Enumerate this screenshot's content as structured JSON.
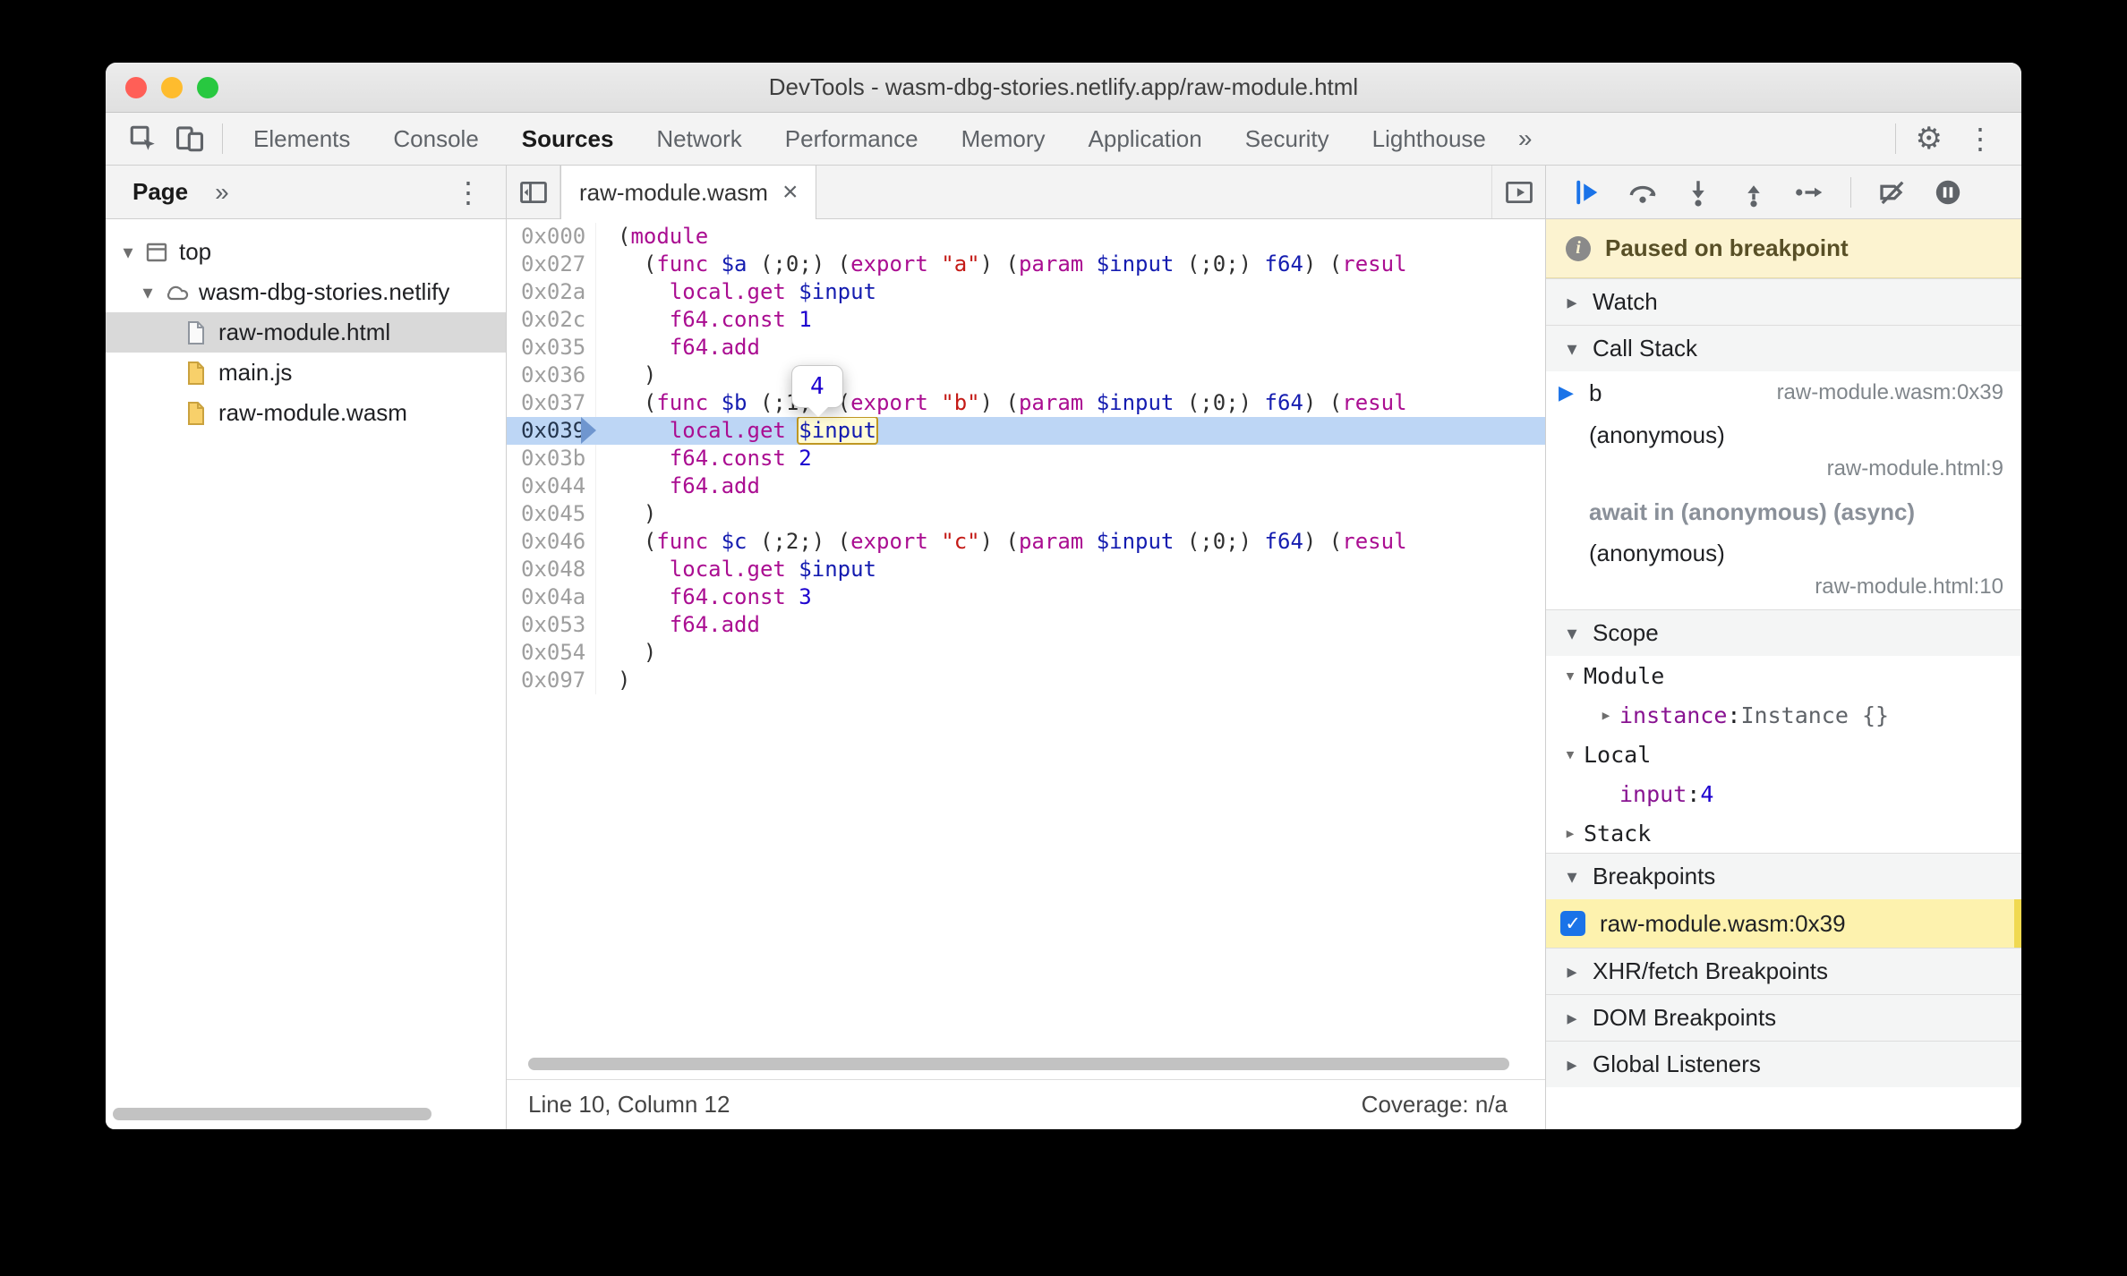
{
  "window": {
    "title": "DevTools - wasm-dbg-stories.netlify.app/raw-module.html"
  },
  "icons": {
    "settings_gear": "⚙",
    "menu_kebab": "⋮",
    "more_tabs": "»",
    "close": "×",
    "cloud": "☁",
    "check": "✓",
    "info": "i",
    "twisty_open": "▾",
    "twisty_closed": "▸",
    "active_frame": "▶"
  },
  "main_toolbar": {
    "active_tab": "Sources",
    "tabs": [
      "Elements",
      "Console",
      "Sources",
      "Network",
      "Performance",
      "Memory",
      "Application",
      "Security",
      "Lighthouse"
    ]
  },
  "navigator": {
    "tab_label": "Page",
    "tree": [
      {
        "label": "top",
        "level": 0,
        "icon": "frame",
        "expanded": true
      },
      {
        "label": "wasm-dbg-stories.netlify",
        "level": 1,
        "icon": "cloud",
        "expanded": true
      },
      {
        "label": "raw-module.html",
        "level": 2,
        "icon": "doc",
        "selected": true
      },
      {
        "label": "main.js",
        "level": 2,
        "icon": "script"
      },
      {
        "label": "raw-module.wasm",
        "level": 2,
        "icon": "script"
      }
    ]
  },
  "editor": {
    "tab_label": "raw-module.wasm",
    "value_tooltip": "4",
    "status": {
      "left": "Line 10, Column 12",
      "right": "Coverage: n/a"
    },
    "lines": [
      {
        "offset": "0x000",
        "tokens": [
          [
            "p",
            "("
          ],
          [
            "k",
            "module"
          ]
        ]
      },
      {
        "offset": "0x027",
        "tokens": [
          [
            "p",
            "  ("
          ],
          [
            "k",
            "func"
          ],
          [
            "p",
            " "
          ],
          [
            "v",
            "$a"
          ],
          [
            "p",
            " (;0;) ("
          ],
          [
            "k",
            "export"
          ],
          [
            "p",
            " "
          ],
          [
            "s",
            "\"a\""
          ],
          [
            "p",
            ") ("
          ],
          [
            "k",
            "param"
          ],
          [
            "p",
            " "
          ],
          [
            "v",
            "$input"
          ],
          [
            "p",
            " (;0;) "
          ],
          [
            "v",
            "f64"
          ],
          [
            "p",
            ") ("
          ],
          [
            "k",
            "resul"
          ]
        ]
      },
      {
        "offset": "0x02a",
        "tokens": [
          [
            "p",
            "    "
          ],
          [
            "k",
            "local.get"
          ],
          [
            "p",
            " "
          ],
          [
            "v",
            "$input"
          ]
        ]
      },
      {
        "offset": "0x02c",
        "tokens": [
          [
            "p",
            "    "
          ],
          [
            "k",
            "f64.const"
          ],
          [
            "p",
            " "
          ],
          [
            "n",
            "1"
          ]
        ]
      },
      {
        "offset": "0x035",
        "tokens": [
          [
            "p",
            "    "
          ],
          [
            "k",
            "f64.add"
          ]
        ]
      },
      {
        "offset": "0x036",
        "tokens": [
          [
            "p",
            "  )"
          ]
        ]
      },
      {
        "offset": "0x037",
        "tokens": [
          [
            "p",
            "  ("
          ],
          [
            "k",
            "func"
          ],
          [
            "p",
            " "
          ],
          [
            "v",
            "$b"
          ],
          [
            "p",
            " (;1;) ("
          ],
          [
            "k",
            "export"
          ],
          [
            "p",
            " "
          ],
          [
            "s",
            "\"b\""
          ],
          [
            "p",
            ") ("
          ],
          [
            "k",
            "param"
          ],
          [
            "p",
            " "
          ],
          [
            "v",
            "$input"
          ],
          [
            "p",
            " (;0;) "
          ],
          [
            "v",
            "f64"
          ],
          [
            "p",
            ") ("
          ],
          [
            "k",
            "resul"
          ]
        ]
      },
      {
        "offset": "0x039",
        "current": true,
        "tokens": [
          [
            "p",
            "    "
          ],
          [
            "k",
            "local.get"
          ],
          [
            "p",
            " "
          ],
          [
            "v",
            "$input",
            "eval"
          ]
        ]
      },
      {
        "offset": "0x03b",
        "tokens": [
          [
            "p",
            "    "
          ],
          [
            "k",
            "f64.const"
          ],
          [
            "p",
            " "
          ],
          [
            "n",
            "2"
          ]
        ]
      },
      {
        "offset": "0x044",
        "tokens": [
          [
            "p",
            "    "
          ],
          [
            "k",
            "f64.add"
          ]
        ]
      },
      {
        "offset": "0x045",
        "tokens": [
          [
            "p",
            "  )"
          ]
        ]
      },
      {
        "offset": "0x046",
        "tokens": [
          [
            "p",
            "  ("
          ],
          [
            "k",
            "func"
          ],
          [
            "p",
            " "
          ],
          [
            "v",
            "$c"
          ],
          [
            "p",
            " (;2;) ("
          ],
          [
            "k",
            "export"
          ],
          [
            "p",
            " "
          ],
          [
            "s",
            "\"c\""
          ],
          [
            "p",
            ") ("
          ],
          [
            "k",
            "param"
          ],
          [
            "p",
            " "
          ],
          [
            "v",
            "$input"
          ],
          [
            "p",
            " (;0;) "
          ],
          [
            "v",
            "f64"
          ],
          [
            "p",
            ") ("
          ],
          [
            "k",
            "resul"
          ]
        ]
      },
      {
        "offset": "0x048",
        "tokens": [
          [
            "p",
            "    "
          ],
          [
            "k",
            "local.get"
          ],
          [
            "p",
            " "
          ],
          [
            "v",
            "$input"
          ]
        ]
      },
      {
        "offset": "0x04a",
        "tokens": [
          [
            "p",
            "    "
          ],
          [
            "k",
            "f64.const"
          ],
          [
            "p",
            " "
          ],
          [
            "n",
            "3"
          ]
        ]
      },
      {
        "offset": "0x053",
        "tokens": [
          [
            "p",
            "    "
          ],
          [
            "k",
            "f64.add"
          ]
        ]
      },
      {
        "offset": "0x054",
        "tokens": [
          [
            "p",
            "  )"
          ]
        ]
      },
      {
        "offset": "0x097",
        "tokens": [
          [
            "p",
            ")"
          ]
        ]
      }
    ]
  },
  "debugger": {
    "paused_message": "Paused on breakpoint",
    "sections": {
      "watch": "Watch",
      "call_stack": "Call Stack",
      "scope": "Scope",
      "breakpoints": "Breakpoints",
      "xhr": "XHR/fetch Breakpoints",
      "dom": "DOM Breakpoints",
      "global": "Global Listeners"
    },
    "call_stack": [
      {
        "name": "b",
        "location": "raw-module.wasm:0x39",
        "active": true
      },
      {
        "name": "(anonymous)",
        "location": "raw-module.html:9"
      },
      {
        "async_separator": "await in (anonymous) (async)"
      },
      {
        "name": "(anonymous)",
        "location": "raw-module.html:10"
      }
    ],
    "scope": [
      {
        "kind": "scope",
        "name": "Module",
        "twisty": "open"
      },
      {
        "kind": "prop",
        "name": "instance",
        "value": "Instance {}",
        "vtype": "object",
        "twisty": "closed"
      },
      {
        "kind": "scope",
        "name": "Local",
        "twisty": "open"
      },
      {
        "kind": "prop",
        "name": "input",
        "value": "4",
        "vtype": "number"
      },
      {
        "kind": "scope",
        "name": "Stack",
        "twisty": "closed"
      }
    ],
    "breakpoints": [
      {
        "label": "raw-module.wasm:0x39",
        "checked": true,
        "highlighted": true
      }
    ]
  },
  "colors": {
    "accent_blue": "#1a73e8",
    "execution_line_bg": "#bdd6f5",
    "paused_banner_bg": "#fcf3d0",
    "breakpoint_hit_bg": "#fdf2ae",
    "selected_row_bg": "#d9d9d9",
    "keyword": "#aa0d91",
    "variable": "#141cb0",
    "number": "#1c00cf",
    "string": "#c41a16",
    "traffic_red": "#ff5f57",
    "traffic_yellow": "#febc2e",
    "traffic_green": "#28c840"
  }
}
